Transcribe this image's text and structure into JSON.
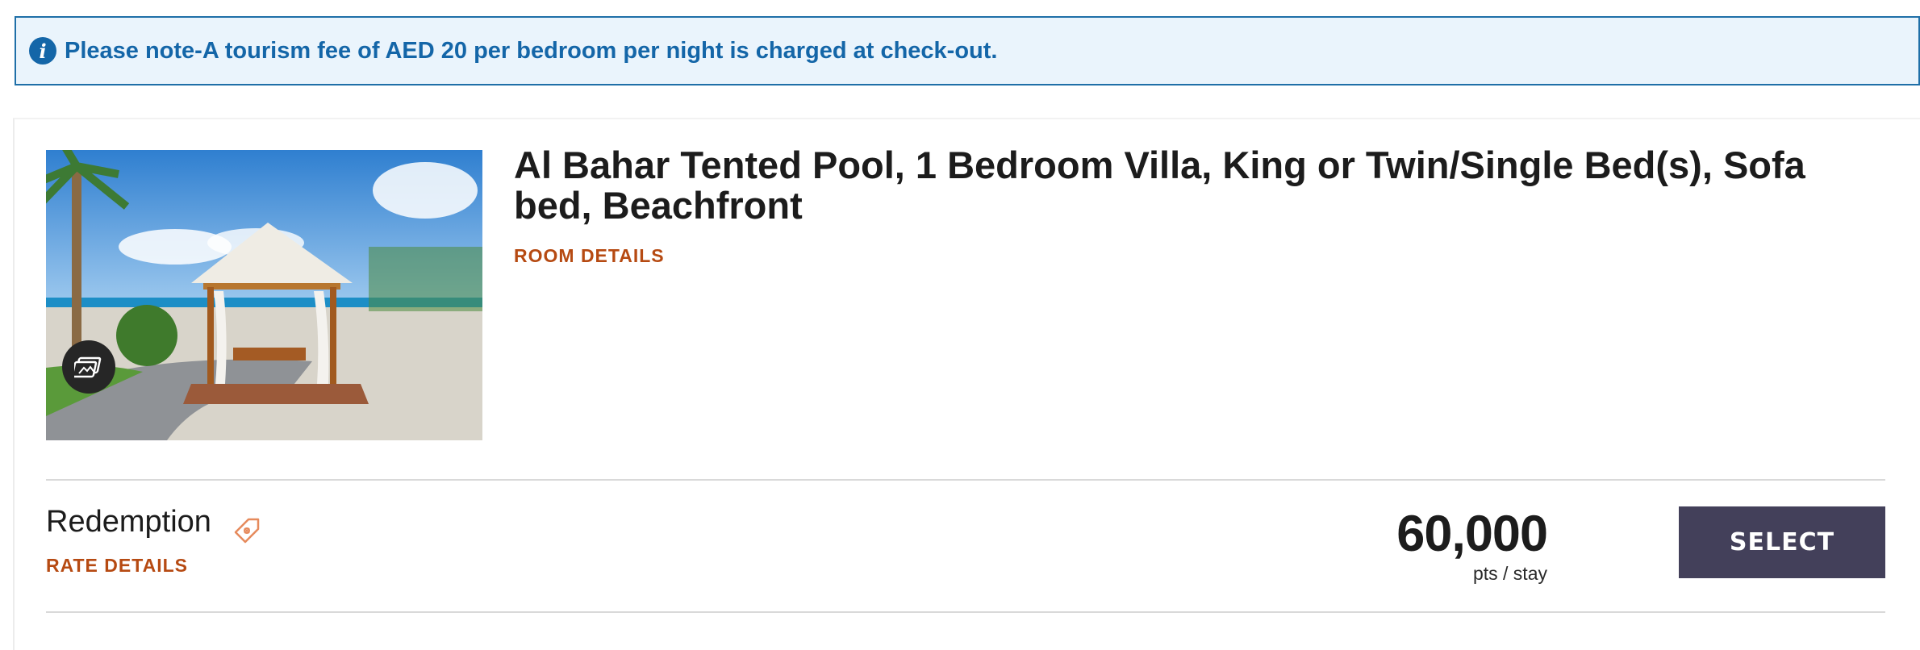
{
  "notice": {
    "icon": "info-icon",
    "text": "Please note-A tourism fee of AED 20 per bedroom per night is charged at check-out."
  },
  "room": {
    "title": "Al Bahar Tented Pool, 1 Bedroom Villa, King or Twin/Single Bed(s), Sofa bed, Beachfront",
    "details_link": "ROOM DETAILS",
    "gallery_icon": "photo-gallery-icon"
  },
  "rate": {
    "name": "Redemption",
    "tag_icon": "points-tag-icon",
    "details_link": "RATE DETAILS",
    "price": "60,000",
    "price_unit": "pts / stay",
    "select_label": "SELECT"
  },
  "colors": {
    "notice_bg": "#eaf4fc",
    "notice_accent": "#1466a8",
    "link_orange": "#b64a12",
    "select_button": "#43405a"
  }
}
